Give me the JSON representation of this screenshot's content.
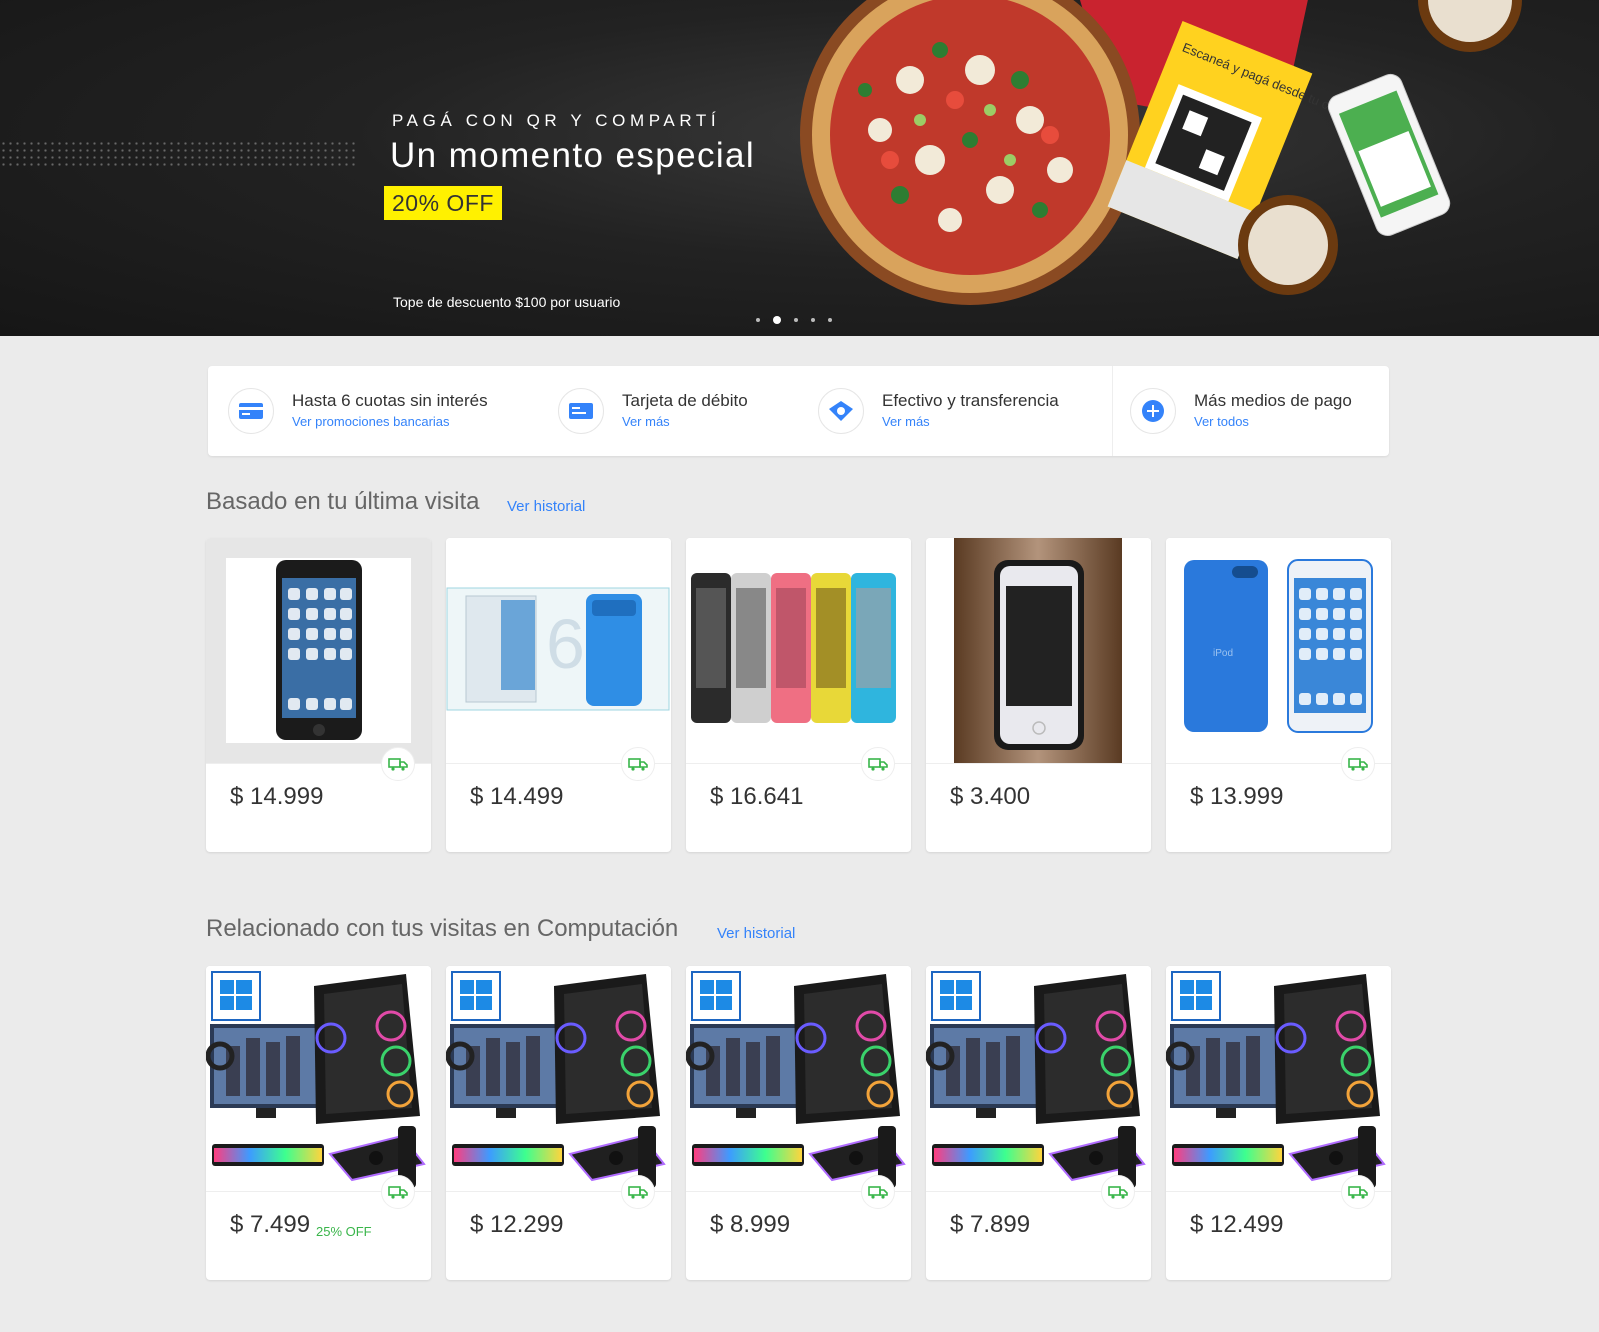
{
  "hero": {
    "eyebrow": "PAGÁ CON QR Y COMPARTÍ",
    "title": "Un momento especial",
    "badge": "20% OFF",
    "note": "Tope de descuento $100 por usuario",
    "qr_card_text": "Escaneá y pagá desde tu celular",
    "slides": 5,
    "active_slide": 2
  },
  "payments": [
    {
      "title": "Hasta 6 cuotas sin interés",
      "link": "Ver promociones bancarias",
      "icon": "credit-card-icon"
    },
    {
      "title": "Tarjeta de débito",
      "link": "Ver más",
      "icon": "debit-card-icon"
    },
    {
      "title": "Efectivo y transferencia",
      "link": "Ver más",
      "icon": "cash-icon"
    },
    {
      "title": "Más medios de pago",
      "link": "Ver todos",
      "icon": "plus-icon"
    }
  ],
  "sections": [
    {
      "title": "Basado en tu última visita",
      "link": "Ver historial",
      "items": [
        {
          "price": "$ 14.999",
          "free_shipping": true,
          "image": "ipod-black"
        },
        {
          "price": "$ 14.499",
          "free_shipping": true,
          "image": "ipod-blue-box"
        },
        {
          "price": "$ 16.641",
          "free_shipping": true,
          "image": "ipod-colors"
        },
        {
          "price": "$ 3.400",
          "free_shipping": false,
          "image": "ipod-wood"
        },
        {
          "price": "$ 13.999",
          "free_shipping": true,
          "image": "ipod-blue-pair"
        }
      ]
    },
    {
      "title": "Relacionado con tus visitas en Computación",
      "link": "Ver historial",
      "items": [
        {
          "price": "$ 7.499",
          "discount": "25% OFF",
          "free_shipping": true,
          "image": "gaming-pc"
        },
        {
          "price": "$ 12.299",
          "free_shipping": true,
          "image": "gaming-pc"
        },
        {
          "price": "$ 8.999",
          "free_shipping": true,
          "image": "gaming-pc"
        },
        {
          "price": "$ 7.899",
          "free_shipping": true,
          "image": "gaming-pc"
        },
        {
          "price": "$ 12.499",
          "free_shipping": true,
          "image": "gaming-pc"
        }
      ]
    }
  ],
  "colors": {
    "accent": "#3483fa",
    "green": "#39b54a",
    "yellow": "#fff100"
  }
}
